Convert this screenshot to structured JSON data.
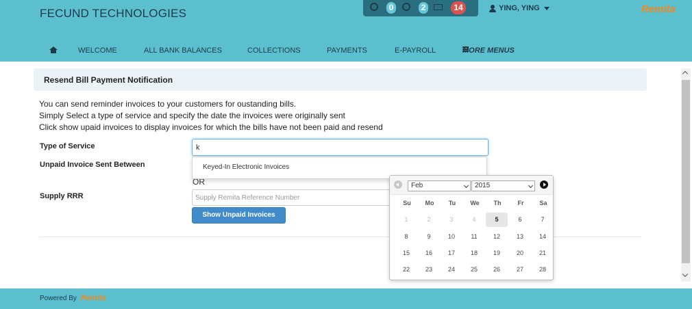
{
  "app": {
    "brand": "FECUND TECHNOLOGIES",
    "logo": "Remita",
    "user": "YING, YING",
    "notifications": {
      "alerts": "0",
      "tasks": "2",
      "messages": "14"
    },
    "colors": {
      "header": "#5cbfce",
      "primary": "#428bca",
      "badge_red": "#d9534f",
      "logo": "#f08a1e"
    }
  },
  "nav": {
    "items": [
      "WELCOME",
      "ALL BANK BALANCES",
      "COLLECTIONS",
      "PAYMENTS",
      "E-PAYROLL"
    ],
    "more": "MORE MENUS"
  },
  "panel": {
    "title": "Resend Bill Payment Notification"
  },
  "description": [
    "You can send reminder invoices to your customers for oustanding bills.",
    "Simply Select a type of service and specify the date the invoices were originally sent",
    "Click show upaid invoices to display invoices for which the bills have not been paid and resend"
  ],
  "form": {
    "type_label": "Type of Service",
    "type_value": "k",
    "suggestion": "Keyed-In Electronic Invoices",
    "unpaid_label": "Unpaid Invoice Sent Between",
    "or_text": "OR",
    "rrr_label": "Supply RRR",
    "rrr_placeholder": "Supply Remita Reference Number",
    "show_button": "Show Unpaid Invoices"
  },
  "datepicker": {
    "month": "Feb",
    "year": "2015",
    "weekdays": [
      "Su",
      "Mo",
      "Tu",
      "We",
      "Th",
      "Fr",
      "Sa"
    ],
    "weeks": [
      [
        "1",
        "2",
        "3",
        "4",
        "5",
        "6",
        "7"
      ],
      [
        "8",
        "9",
        "10",
        "11",
        "12",
        "13",
        "14"
      ],
      [
        "15",
        "16",
        "17",
        "18",
        "19",
        "20",
        "21"
      ],
      [
        "22",
        "23",
        "24",
        "25",
        "26",
        "27",
        "28"
      ]
    ],
    "today": "5"
  },
  "footer": {
    "powered": "Powered By",
    "logo": "Remita"
  }
}
